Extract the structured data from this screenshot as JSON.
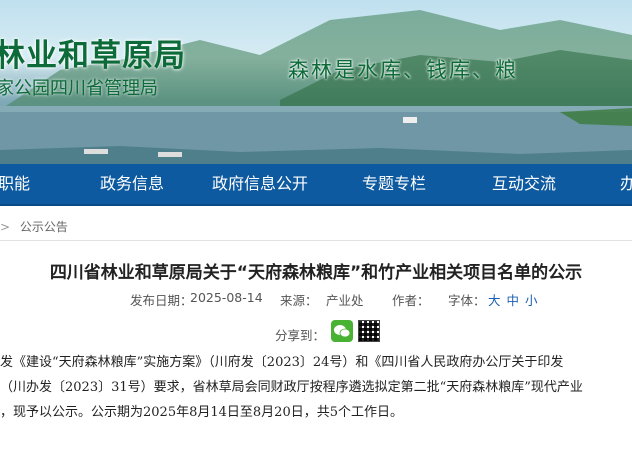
{
  "header": {
    "title": "林业和草原局",
    "subtitle": "家公园四川省管理局",
    "slogan": "森林是水库、钱库、粮"
  },
  "nav": {
    "items": [
      {
        "label": "职能"
      },
      {
        "label": "政务信息"
      },
      {
        "label": "政府信息公开"
      },
      {
        "label": "专题专栏"
      },
      {
        "label": "互动交流"
      },
      {
        "label": "办"
      }
    ]
  },
  "breadcrumb": {
    "items": [
      {
        "label": "公示公告"
      }
    ]
  },
  "article": {
    "title": "四川省林业和草原局关于“天府森林粮库”和竹产业相关项目名单的公示",
    "meta": {
      "date_label": "发布日期：",
      "date": "2025-08-14",
      "source_label": "来源：",
      "source": "产业处",
      "author_label": "作者：",
      "font_label": "字体：",
      "font_sizes": [
        "大",
        "中",
        "小"
      ]
    },
    "share_label": "分享到：",
    "body_lines": [
      "发《建设“天府森林粮库”实施方案》（川府发〔2023〕24号）和《四川省人民政府办公厅关于印发",
      "（川办发〔2023〕31号）要求，省林草局会同财政厅按程序遴选拟定第二批“天府森林粮库”现代产业",
      "，现予以公示。公示期为2025年8月14日至8月20日，共5个工作日。"
    ]
  },
  "colors": {
    "nav_bg": "#0e5aa0",
    "title_green": "#0d6b3a",
    "link_blue": "#1a5fb4",
    "wechat_green": "#49b233"
  },
  "icons": {
    "share": [
      "wechat-icon",
      "qrcode-icon"
    ]
  }
}
